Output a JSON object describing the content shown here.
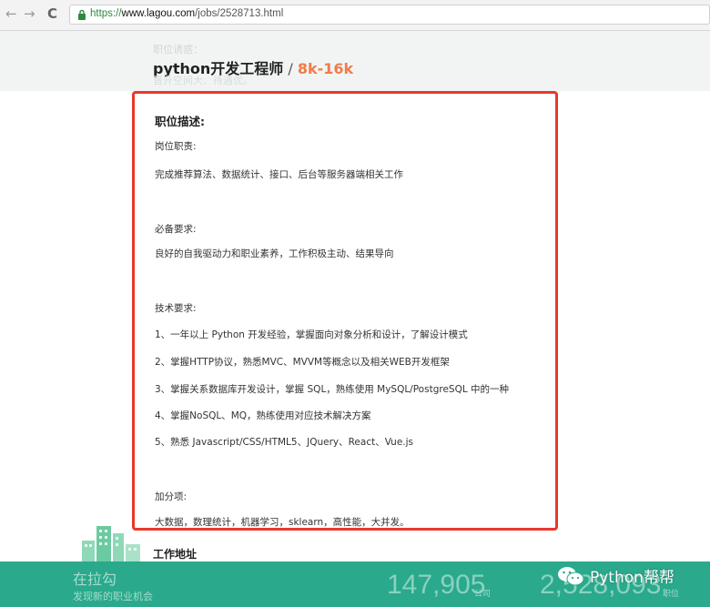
{
  "browser": {
    "back_glyph": "←",
    "forward_glyph": "→",
    "reload_glyph": "C",
    "url_scheme": "https://",
    "url_host": "www.lagou.com",
    "url_path": "/jobs/2528713.html"
  },
  "header": {
    "ghost_top": "职位诱惑：",
    "job_name": "python开发工程师",
    "separator": " / ",
    "salary": "8k-16k",
    "ghost_bottom": "晋升空间大、待遇优。"
  },
  "description": {
    "heading": "职位描述:",
    "lines": [
      "岗位职责:",
      "完成推荐算法、数据统计、接口、后台等服务器端相关工作",
      "必备要求:",
      "良好的自我驱动力和职业素养，工作积极主动、结果导向",
      "技术要求:",
      "1、一年以上 Python 开发经验，掌握面向对象分析和设计，了解设计模式",
      "2、掌握HTTP协议，熟悉MVC、MVVM等概念以及相关WEB开发框架",
      "3、掌握关系数据库开发设计，掌握 SQL，熟练使用 MySQL/PostgreSQL 中的一种",
      "4、掌握NoSQL、MQ，熟练使用对应技术解决方案",
      "5、熟悉 Javascript/CSS/HTML5、JQuery、React、Vue.js",
      "加分项:",
      "大数据，数理统计，机器学习，sklearn，高性能，大并发。"
    ]
  },
  "address": {
    "label": "工作地址"
  },
  "footer": {
    "brand": "在拉勾",
    "slogan": "发现新的职业机会",
    "companies_count": "147,905",
    "companies_unit": "公司",
    "jobs_count": "2,528,093",
    "jobs_unit": "职位"
  },
  "watermark": {
    "text": "Python帮帮"
  },
  "colors": {
    "salary": "#f07c4a",
    "highlight_border": "#e8382b",
    "footer_bg": "#2aa98c"
  }
}
